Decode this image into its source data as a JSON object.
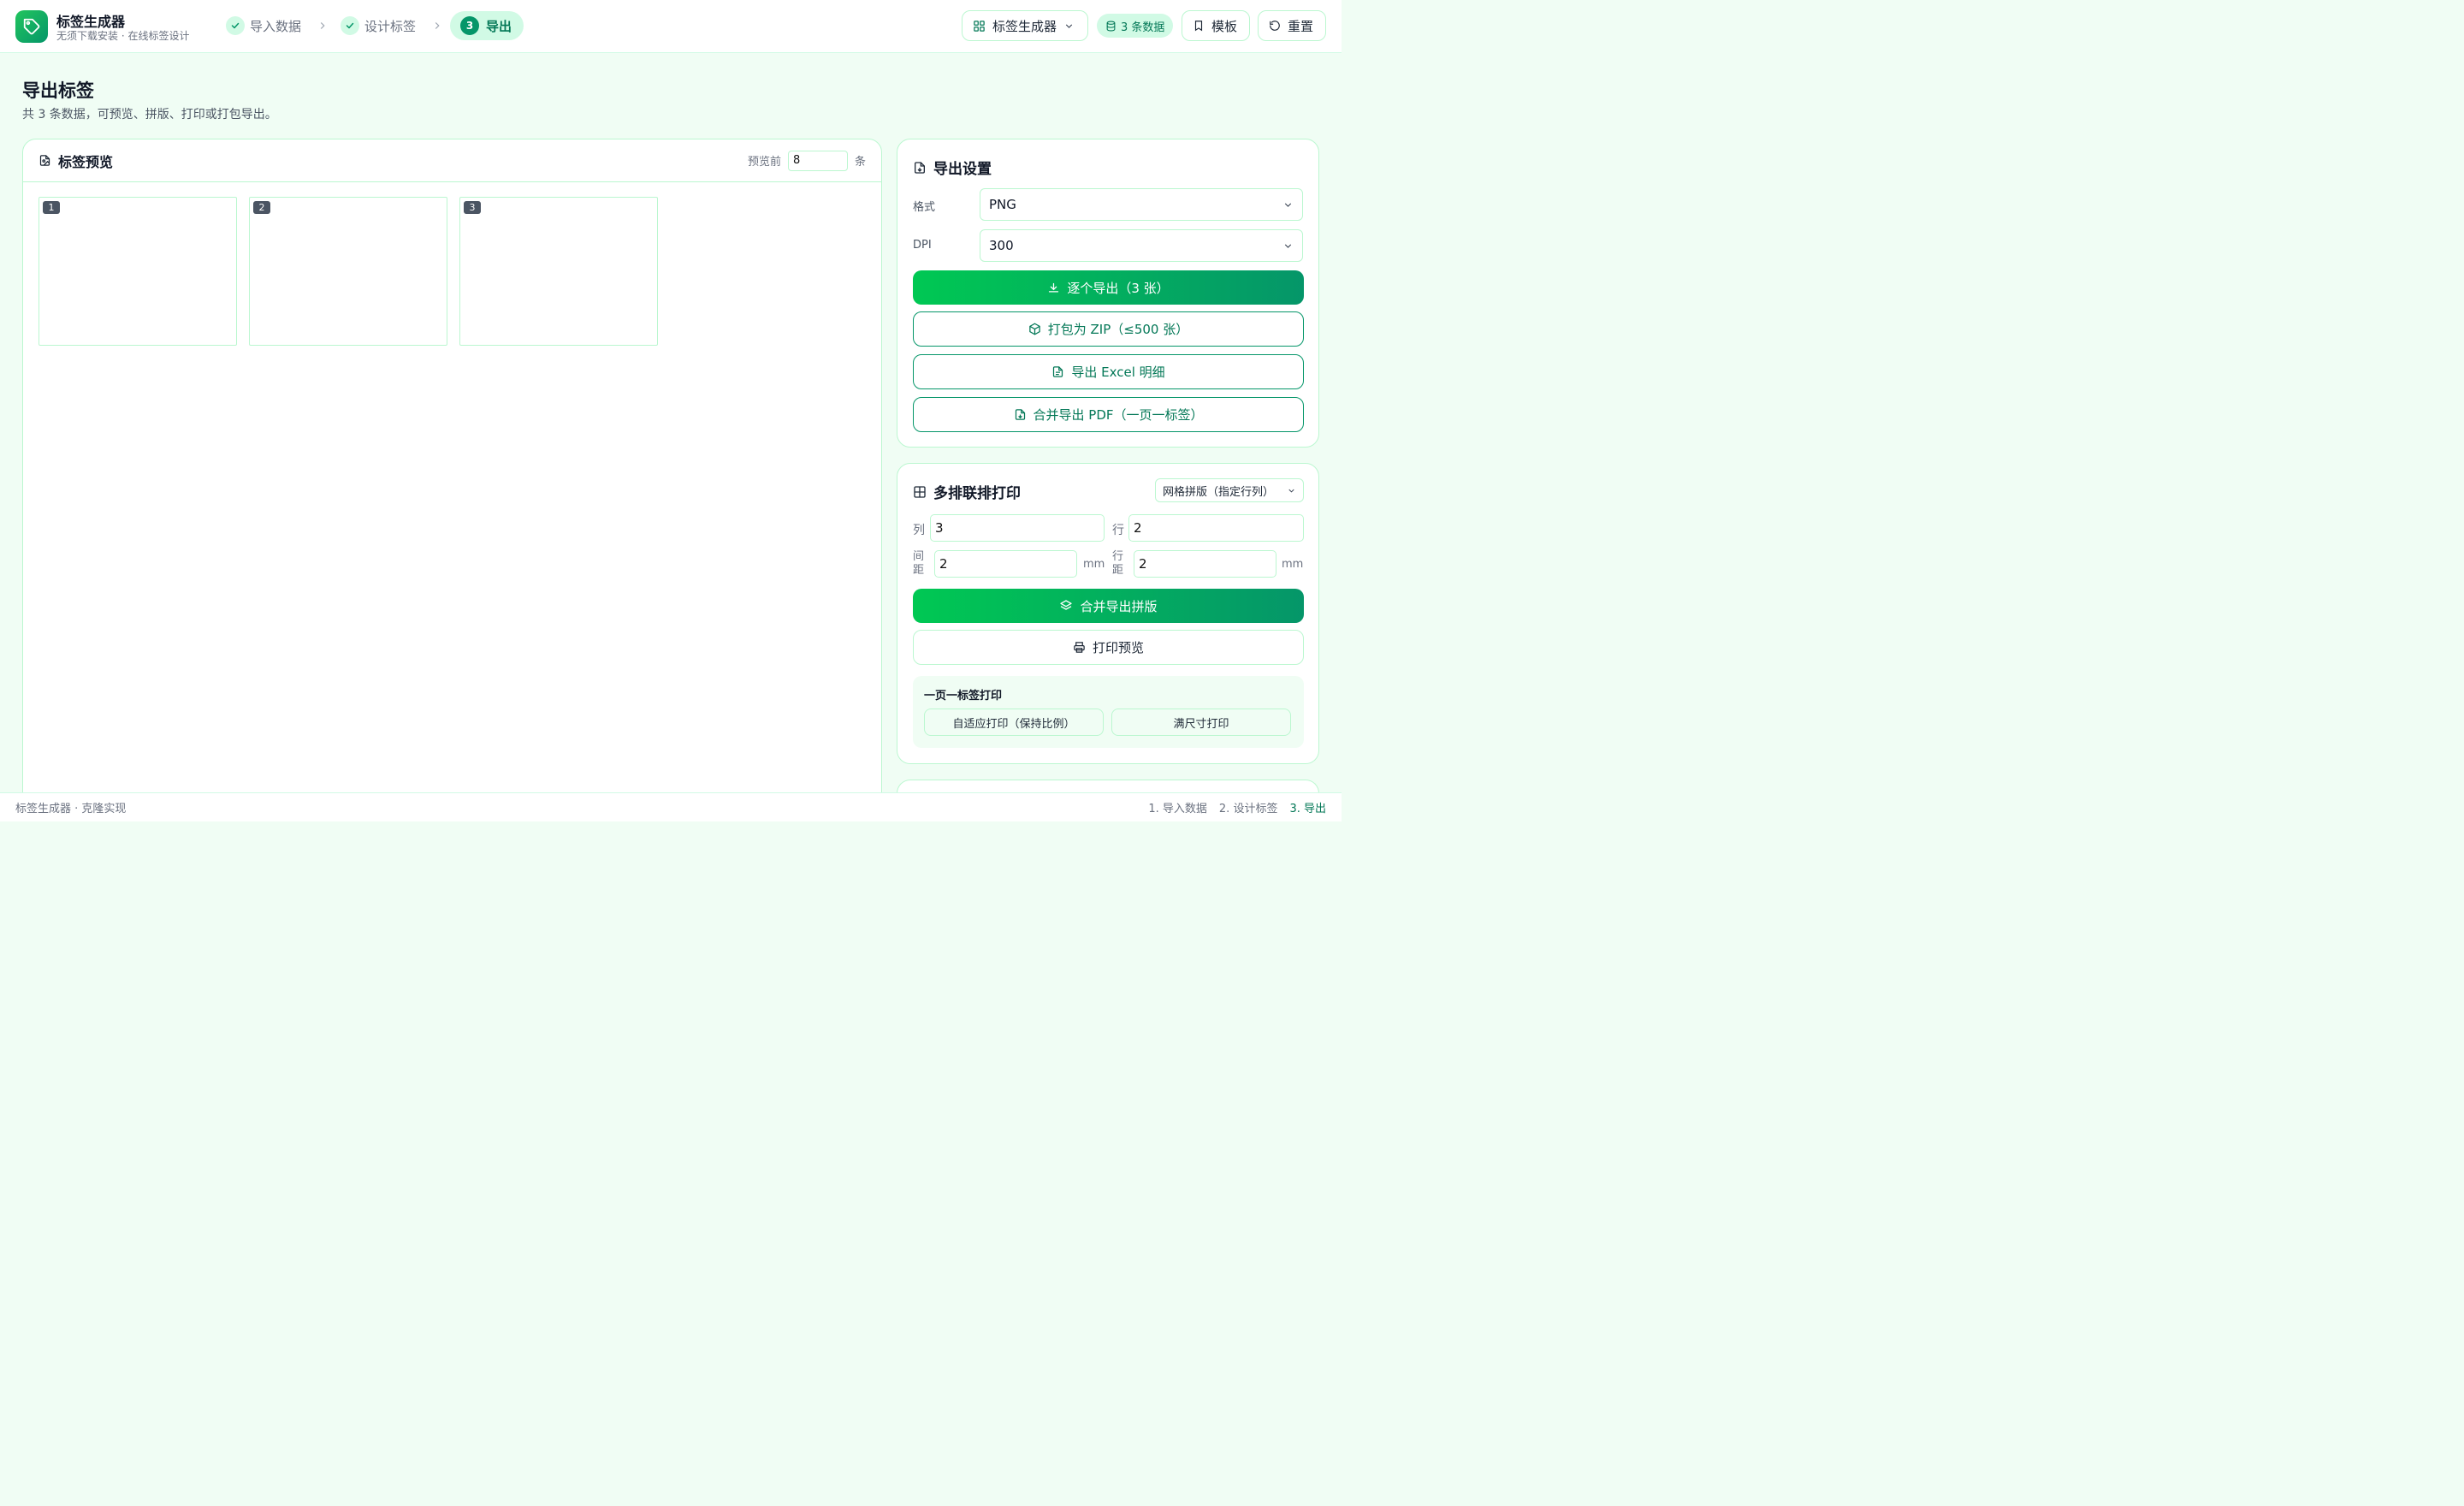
{
  "header": {
    "app_title": "标签生成器",
    "app_subtitle": "无须下载安装 · 在线标签设计",
    "steps": [
      {
        "label": "导入数据",
        "state": "done"
      },
      {
        "label": "设计标签",
        "state": "done"
      },
      {
        "label": "导出",
        "state": "active",
        "number": "3"
      }
    ],
    "app_switch_label": "标签生成器",
    "data_badge": "3 条数据",
    "template_label": "模板",
    "reset_label": "重置"
  },
  "page": {
    "title": "导出标签",
    "subtitle": "共 3 条数据，可预览、拼版、打印或打包导出。"
  },
  "preview": {
    "title": "标签预览",
    "count_prefix": "预览前",
    "count_value": "8",
    "count_suffix": "条",
    "labels": [
      "1",
      "2",
      "3"
    ]
  },
  "export_settings": {
    "title": "导出设置",
    "format_label": "格式",
    "format_value": "PNG",
    "dpi_label": "DPI",
    "dpi_value": "300",
    "export_each": "逐个导出（3 张）",
    "zip": "打包为 ZIP（≤500 张）",
    "excel": "导出 Excel 明细",
    "pdf": "合并导出 PDF（一页一标签）"
  },
  "multi_print": {
    "title": "多排联排打印",
    "mode": "网格拼版（指定行列）",
    "cols_label": "列",
    "cols_value": "3",
    "rows_label": "行",
    "rows_value": "2",
    "gap_label": "间距",
    "gap_value": "2",
    "gap_unit": "mm",
    "row_gap_label": "行距",
    "row_gap_value": "2",
    "row_gap_unit": "mm",
    "merge_export": "合并导出拼版",
    "print_preview": "打印预览",
    "single_page_title": "一页一标签打印",
    "fit_print": "自适应打印（保持比例）",
    "full_print": "满尺寸打印"
  },
  "footer": {
    "left": "标签生成器 · 克隆实现",
    "steps": [
      "1. 导入数据",
      "2. 设计标签",
      "3. 导出"
    ]
  },
  "colors": {
    "accent": "#059669",
    "accent_light": "#d1fae5",
    "background": "#f0fdf4"
  }
}
